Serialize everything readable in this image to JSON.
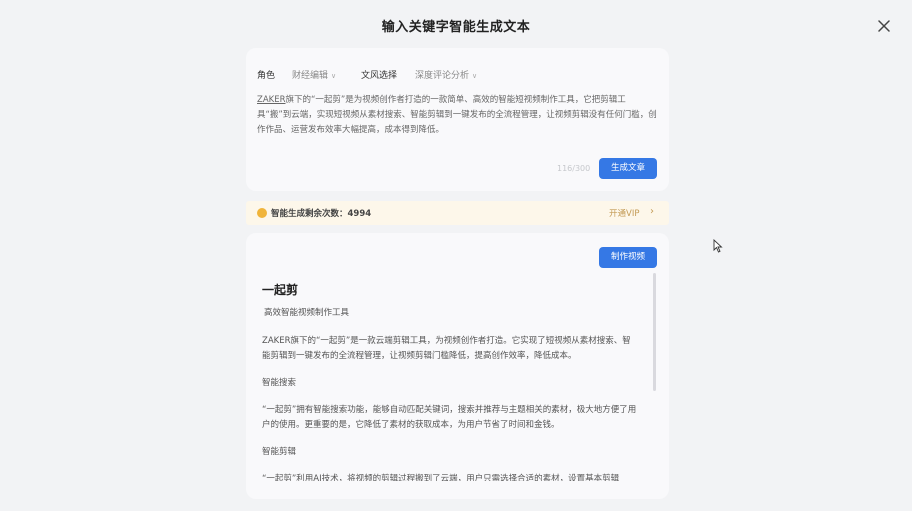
{
  "dialog": {
    "title": "输入关键字智能生成文本"
  },
  "settings": {
    "role_label": "角色",
    "role_value": "财经编辑",
    "style_label": "文风选择",
    "style_value": "深度评论分析"
  },
  "prompt": {
    "brand": "ZAKER",
    "text": "旗下的“一起剪”是为视频创作者打造的一款简单、高效的智能短视频制作工具，它把剪辑工具“搬”到云端，实现短视频从素材搜索、智能剪辑到一键发布的全流程管理，让视频剪辑没有任何门槛，创作作品、运营发布效率大幅提高，成本得到降低。",
    "counter": "116/300"
  },
  "buttons": {
    "generate": "生成文章",
    "make_video": "制作视频"
  },
  "quota": {
    "text": "智能生成剩余次数：4994",
    "vip": "开通VIP"
  },
  "article": {
    "title": "一起剪",
    "subtitle": "高效智能视频制作工具",
    "p1": "ZAKER旗下的“一起剪”是一款云端剪辑工具，为视频创作者打造。它实现了短视频从素材搜索、智能剪辑到一键发布的全流程管理，让视频剪辑门槛降低，提高创作效率，降低成本。",
    "h_search": "智能搜索",
    "p2": "“一起剪”拥有智能搜索功能，能够自动匹配关键词，搜索并推荐与主题相关的素材，极大地方便了用户的使用。更重要的是，它降低了素材的获取成本，为用户节省了时间和金钱。",
    "h_edit": "智能剪辑",
    "p3": "“一起剪”利用AI技术，将视频的剪辑过程搬到了云端，用户只需选择合适的素材，设置基本剪辑"
  },
  "colors": {
    "accent": "#3578e5",
    "quota_bg": "#fdf7ea",
    "vip": "#c39a54"
  },
  "icons": {
    "close": "close-icon",
    "chevron": "chevron-down-icon",
    "coin": "coin-icon",
    "arrow": "chevron-right-icon",
    "cursor": "mouse-pointer-icon"
  }
}
